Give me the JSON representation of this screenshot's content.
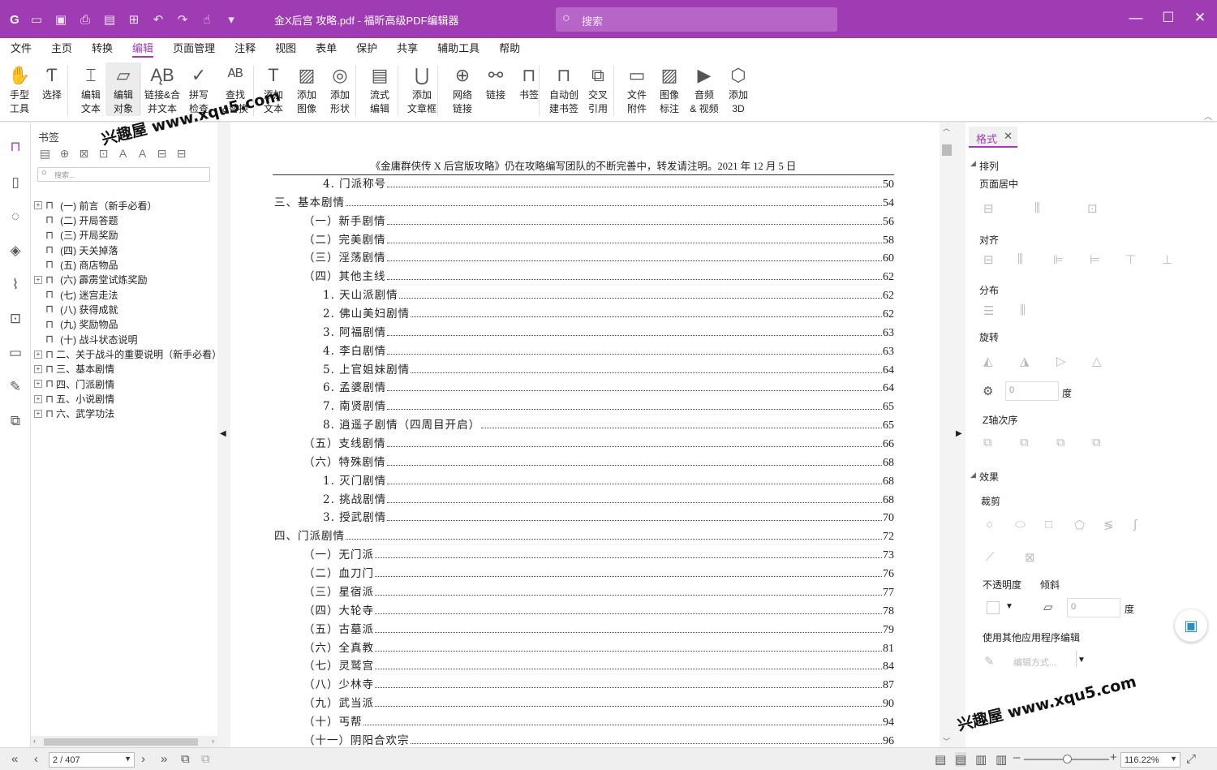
{
  "titlebar": {
    "title": "金X后宫 攻略.pdf - 福昕高级PDF编辑器",
    "search_placeholder": "搜索"
  },
  "menu": [
    "文件",
    "主页",
    "转换",
    "编辑",
    "页面管理",
    "注释",
    "视图",
    "表单",
    "保护",
    "共享",
    "辅助工具",
    "帮助"
  ],
  "menu_active": "编辑",
  "ribbon": [
    {
      "l1": "手型",
      "l2": "工具",
      "icon": "hand-icon"
    },
    {
      "l1": "选择",
      "l2": "",
      "icon": "select-text-icon"
    },
    {
      "l1": "编辑",
      "l2": "文本",
      "icon": "edit-text-icon"
    },
    {
      "l1": "编辑",
      "l2": "对象",
      "icon": "edit-object-icon"
    },
    {
      "l1": "链接&合",
      "l2": "并文本",
      "icon": "link-merge-icon"
    },
    {
      "l1": "拼写",
      "l2": "检查",
      "icon": "spell-check-icon"
    },
    {
      "l1": "查找",
      "l2": "&替换",
      "icon": "find-replace-icon"
    },
    {
      "l1": "添加",
      "l2": "文本",
      "icon": "add-text-icon"
    },
    {
      "l1": "添加",
      "l2": "图像",
      "icon": "add-image-icon"
    },
    {
      "l1": "添加",
      "l2": "形状",
      "icon": "add-shape-icon"
    },
    {
      "l1": "流式",
      "l2": "编辑",
      "icon": "flow-edit-icon"
    },
    {
      "l1": "添加",
      "l2": "文章框",
      "icon": "article-box-icon"
    },
    {
      "l1": "网络",
      "l2": "链接",
      "icon": "web-link-icon"
    },
    {
      "l1": "链接",
      "l2": "",
      "icon": "link-icon"
    },
    {
      "l1": "书签",
      "l2": "",
      "icon": "bookmark-icon"
    },
    {
      "l1": "自动创",
      "l2": "建书签",
      "icon": "auto-bookmark-icon"
    },
    {
      "l1": "交叉",
      "l2": "引用",
      "icon": "cross-reference-icon"
    },
    {
      "l1": "文件",
      "l2": "附件",
      "icon": "file-attachment-icon"
    },
    {
      "l1": "图像",
      "l2": "标注",
      "icon": "image-annotation-icon"
    },
    {
      "l1": "音频",
      "l2": "& 视频",
      "icon": "audio-video-icon"
    },
    {
      "l1": "添加",
      "l2": "3D",
      "icon": "add-3d-icon"
    }
  ],
  "bookmarks_panel": {
    "title": "书签",
    "search_placeholder": "搜索...",
    "items": [
      {
        "label": "(一) 前言（新手必看）",
        "expandable": true,
        "indent": 1
      },
      {
        "label": "(二) 开局答题",
        "expandable": false,
        "indent": 1
      },
      {
        "label": "(三) 开局奖励",
        "expandable": false,
        "indent": 1
      },
      {
        "label": "(四) 天关掉落",
        "expandable": false,
        "indent": 1
      },
      {
        "label": "(五) 商店物品",
        "expandable": false,
        "indent": 1
      },
      {
        "label": "(六) 霹雳堂试炼奖励",
        "expandable": true,
        "indent": 1
      },
      {
        "label": "(七) 迷宫走法",
        "expandable": false,
        "indent": 1
      },
      {
        "label": "(八) 获得成就",
        "expandable": false,
        "indent": 1
      },
      {
        "label": "(九) 奖励物品",
        "expandable": false,
        "indent": 1
      },
      {
        "label": "(十) 战斗状态说明",
        "expandable": false,
        "indent": 1
      },
      {
        "label": "二、关于战斗的重要说明（新手必看）",
        "expandable": true,
        "indent": 0
      },
      {
        "label": "三、基本剧情",
        "expandable": true,
        "indent": 0
      },
      {
        "label": "四、门派剧情",
        "expandable": true,
        "indent": 0
      },
      {
        "label": "五、小说剧情",
        "expandable": true,
        "indent": 0
      },
      {
        "label": "六、武学功法",
        "expandable": true,
        "indent": 0
      }
    ]
  },
  "document": {
    "header": "《金庸群侠传 X 后宫版攻略》仍在攻略编写团队的不断完善中，转发请注明。2021 年 12 月 5 日",
    "toc": [
      {
        "text": "4. 门派称号",
        "page": "50",
        "level": 2
      },
      {
        "text": "三、基本剧情",
        "page": "54",
        "level": 0
      },
      {
        "text": "（一）新手剧情",
        "page": "56",
        "level": 1
      },
      {
        "text": "（二）完美剧情",
        "page": "58",
        "level": 1
      },
      {
        "text": "（三）淫荡剧情",
        "page": "60",
        "level": 1
      },
      {
        "text": "（四）其他主线",
        "page": "62",
        "level": 1
      },
      {
        "text": "1. 天山派剧情",
        "page": "62",
        "level": 2
      },
      {
        "text": "2. 佛山美妇剧情",
        "page": "62",
        "level": 2
      },
      {
        "text": "3. 阿福剧情",
        "page": "63",
        "level": 2
      },
      {
        "text": "4. 李白剧情",
        "page": "63",
        "level": 2
      },
      {
        "text": "5. 上官姐妹剧情",
        "page": "64",
        "level": 2
      },
      {
        "text": "6. 孟婆剧情",
        "page": "64",
        "level": 2
      },
      {
        "text": "7. 南贤剧情",
        "page": "65",
        "level": 2
      },
      {
        "text": "8. 逍遥子剧情（四周目开启）",
        "page": "65",
        "level": 2
      },
      {
        "text": "（五）支线剧情",
        "page": "66",
        "level": 1
      },
      {
        "text": "（六）特殊剧情",
        "page": "68",
        "level": 1
      },
      {
        "text": "1. 灭门剧情",
        "page": "68",
        "level": 2
      },
      {
        "text": "2. 挑战剧情",
        "page": "68",
        "level": 2
      },
      {
        "text": "3. 授武剧情",
        "page": "70",
        "level": 2
      },
      {
        "text": "四、门派剧情",
        "page": "72",
        "level": 0
      },
      {
        "text": "（一）无门派",
        "page": "73",
        "level": 1
      },
      {
        "text": "（二）血刀门",
        "page": "76",
        "level": 1
      },
      {
        "text": "（三）星宿派",
        "page": "77",
        "level": 1
      },
      {
        "text": "（四）大轮寺",
        "page": "78",
        "level": 1
      },
      {
        "text": "（五）古墓派",
        "page": "79",
        "level": 1
      },
      {
        "text": "（六）全真教",
        "page": "81",
        "level": 1
      },
      {
        "text": "（七）灵鹫宫",
        "page": "84",
        "level": 1
      },
      {
        "text": "（八）少林寺",
        "page": "87",
        "level": 1
      },
      {
        "text": "（九）武当派",
        "page": "90",
        "level": 1
      },
      {
        "text": "（十）丐帮",
        "page": "94",
        "level": 1
      },
      {
        "text": "（十一）阴阳合欢宗",
        "page": "96",
        "level": 1
      }
    ]
  },
  "format_panel": {
    "tab": "格式",
    "arrange": "排列",
    "page_center": "页面居中",
    "align": "对齐",
    "distribute": "分布",
    "rotate": "旋转",
    "rotate_value": "0",
    "degree": "度",
    "z_order": "Z轴次序",
    "effects": "效果",
    "crop": "裁剪",
    "opacity": "不透明度",
    "skew": "倾斜",
    "skew_value": "0",
    "degree2": "度",
    "edit_with_other": "使用其他应用程序编辑",
    "edit_method": "编辑方式..."
  },
  "status": {
    "page_display": "2 / 407",
    "zoom": "116.22%"
  },
  "watermark": "兴趣屋 www.xqu5.com",
  "colors": {
    "accent": "#9f3cb4"
  }
}
